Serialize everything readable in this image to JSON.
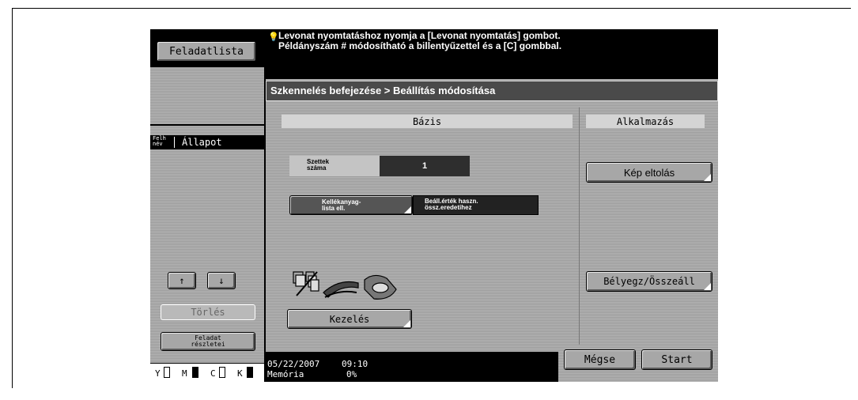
{
  "left_panel": {
    "job_list_button": "Feladatlista",
    "col_user_name": "Felh\nnév",
    "col_status": "Állapot",
    "delete_button": "Törlés",
    "job_details_button": "Feladat\nrészletei",
    "toner": [
      {
        "label": "Y",
        "level": 0.0
      },
      {
        "label": "M",
        "level": 0.9
      },
      {
        "label": "C",
        "level": 0.0
      },
      {
        "label": "K",
        "level": 0.9
      }
    ]
  },
  "message": "Levonat nyomtatáshoz nyomja a [Levonat nyomtatás] gombot. Példányszám # módosítható a billentyűzettel és a [C] gombbal.",
  "title_bar": "Szkennelés befejezése > Beállítás módosítása",
  "basic": {
    "header": "Bázis",
    "sets_label": "Szettek\nszáma",
    "sets_value": "1",
    "consumables_button": "Kellékanyag-\nlista ell.",
    "default_setting_button": "Beáll.érték haszn.\nössz.eredetihez",
    "finishing_button": "Kezelés"
  },
  "application": {
    "header": "Alkalmazás",
    "image_shift_button": "Kép eltolás",
    "stamp_composition_button": "Bélyegz/Összeáll"
  },
  "footer": {
    "date": "05/22/2007",
    "time": "09:10",
    "memory_label": "Memória",
    "memory_value": "0%",
    "cancel_button": "Mégse",
    "start_button": "Start"
  }
}
